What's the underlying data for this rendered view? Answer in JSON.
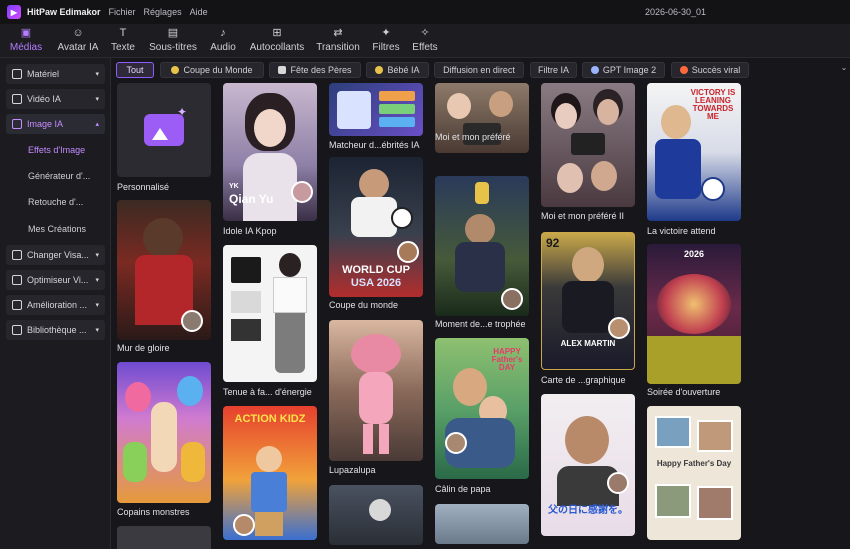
{
  "titlebar": {
    "app_name": "HitPaw Edimakor",
    "menu": [
      "Fichier",
      "Réglages",
      "Aide"
    ],
    "project": "2026-06-30_01"
  },
  "toolbar": {
    "tools": [
      {
        "label": "Médias",
        "icon": "media-icon",
        "active": true
      },
      {
        "label": "Avatar IA",
        "icon": "avatar-icon"
      },
      {
        "label": "Texte",
        "icon": "text-icon"
      },
      {
        "label": "Sous-titres",
        "icon": "subtitles-icon"
      },
      {
        "label": "Audio",
        "icon": "audio-icon"
      },
      {
        "label": "Autocollants",
        "icon": "stickers-icon"
      },
      {
        "label": "Transition",
        "icon": "transition-icon"
      },
      {
        "label": "Filtres",
        "icon": "filters-icon"
      },
      {
        "label": "Effets",
        "icon": "effects-icon"
      }
    ]
  },
  "sidebar": {
    "groups": [
      {
        "label": "Matériel",
        "icon": "folder-icon",
        "chevron": "▾"
      },
      {
        "label": "Vidéo IA",
        "icon": "video-icon",
        "chevron": "▾"
      },
      {
        "label": "Image IA",
        "icon": "image-icon",
        "chevron": "▴",
        "open": true
      },
      {
        "label": "Changer Visa...",
        "icon": "face-swap-icon",
        "chevron": "▾"
      },
      {
        "label": "Optimiseur Vi...",
        "icon": "optimizer-icon",
        "chevron": "▾"
      },
      {
        "label": "Amélioration ...",
        "icon": "enhance-icon",
        "chevron": "▾"
      },
      {
        "label": "Bibliothèque ...",
        "icon": "library-icon",
        "chevron": "▾"
      }
    ],
    "sub_items": [
      {
        "label": "Effets d'Image",
        "active": true
      },
      {
        "label": "Générateur d'..."
      },
      {
        "label": "Retouche d'..."
      },
      {
        "label": "Mes Créations"
      }
    ]
  },
  "filters": {
    "chips": [
      {
        "label": "Tout",
        "active": true
      },
      {
        "label": "Coupe du Monde",
        "icon_color": "#e8c34a"
      },
      {
        "label": "Fête des Pères",
        "icon_color": "#d8d8d8"
      },
      {
        "label": "Bébé IA",
        "icon_color": "#e8c34a"
      },
      {
        "label": "Diffusion en direct"
      },
      {
        "label": "Filtre IA"
      },
      {
        "label": "GPT Image 2",
        "icon_color": "#9ab4ff"
      },
      {
        "label": "Succès viral",
        "icon_color": "#ff6a3d"
      }
    ],
    "expand_icon": "⌄"
  },
  "templates": {
    "personnalise": "Personnalisé",
    "mur_de_gloire": "Mur de gloire",
    "copains_monstres": "Copains monstres",
    "idole_kpop": "Idole IA Kpop",
    "tenue": "Tenue à fa... d'énergie",
    "matcheur": "Matcheur d...ébrités IA",
    "coupe_du_monde": "Coupe du monde",
    "lupazalupa": "Lupazalupa",
    "moi_et_mon_prefere": "Moi et mon préféré",
    "moment_trophee": "Moment de...e trophée",
    "calin_de_papa": "Câlin de papa",
    "moi_et_mon_prefere_2": "Moi et mon préféré II",
    "carte_graphique": "Carte de ...graphique",
    "victoire_attend": "La victoire attend",
    "soiree_ouverture": "Soirée d'ouverture"
  },
  "thumb_text": {
    "kpop_small": "YK",
    "kpop_name": "Qian Yu",
    "worldcup_line1": "WORLD CUP",
    "worldcup_line2": "USA 2026",
    "action_kidz": "ACTION KIDZ",
    "fathers_day": "HAPPY Father's DAY",
    "card_number": "92",
    "card_name": "ALEX MARTIN",
    "victory": "VICTORY IS LEANING TOWARDS ME",
    "opening_year": "2026",
    "jp_text": "父の日に感謝を。",
    "fathers_day_2": "Happy Father's Day"
  }
}
